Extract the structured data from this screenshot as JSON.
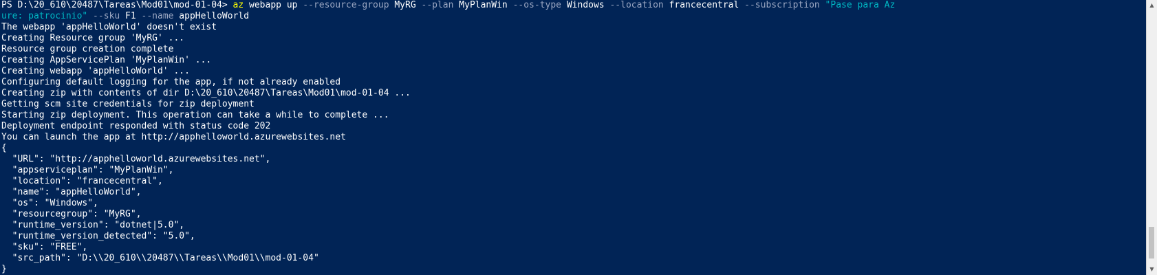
{
  "command": {
    "prompt": "PS D:\\20_610\\20487\\Tareas\\Mod01\\mod-01-04> ",
    "tool": "az",
    "args_1": " webapp up ",
    "flag_resource_group": "--resource-group",
    "val_resource_group": " MyRG ",
    "flag_plan": "--plan",
    "val_plan": " MyPlanWin ",
    "flag_os_type": "--os-type",
    "val_os_type": " Windows ",
    "flag_location": "--location",
    "val_location": " francecentral ",
    "flag_subscription": "--subscription",
    "val_subscription_part1": " \"Pase para Az",
    "val_subscription_part2": "ure: patrocinio\"",
    "flag_sku": " --sku",
    "val_sku": " F1 ",
    "flag_name": "--name",
    "val_name": " appHelloWorld"
  },
  "output": {
    "lines": [
      "The webapp 'appHelloWorld' doesn't exist",
      "Creating Resource group 'MyRG' ...",
      "Resource group creation complete",
      "Creating AppServicePlan 'MyPlanWin' ...",
      "Creating webapp 'appHelloWorld' ...",
      "Configuring default logging for the app, if not already enabled",
      "Creating zip with contents of dir D:\\20_610\\20487\\Tareas\\Mod01\\mod-01-04 ...",
      "Getting scm site credentials for zip deployment",
      "Starting zip deployment. This operation can take a while to complete ...",
      "Deployment endpoint responded with status code 202",
      "You can launch the app at http://apphelloworld.azurewebsites.net"
    ]
  },
  "json_result": {
    "open": "{",
    "lines": [
      "  \"URL\": \"http://apphelloworld.azurewebsites.net\",",
      "  \"appserviceplan\": \"MyPlanWin\",",
      "  \"location\": \"francecentral\",",
      "  \"name\": \"appHelloWorld\",",
      "  \"os\": \"Windows\",",
      "  \"resourcegroup\": \"MyRG\",",
      "  \"runtime_version\": \"dotnet|5.0\",",
      "  \"runtime_version_detected\": \"5.0\",",
      "  \"sku\": \"FREE\",",
      "  \"src_path\": \"D:\\\\20_610\\\\20487\\\\Tareas\\\\Mod01\\\\mod-01-04\""
    ],
    "close": "}"
  },
  "scrollbar": {
    "up_glyph": "▲",
    "down_glyph": "▼"
  },
  "colors": {
    "background": "#012456",
    "text": "#ffffff",
    "command": "#ffff00",
    "flag": "#9aa6c1",
    "string": "#00b7c3"
  }
}
